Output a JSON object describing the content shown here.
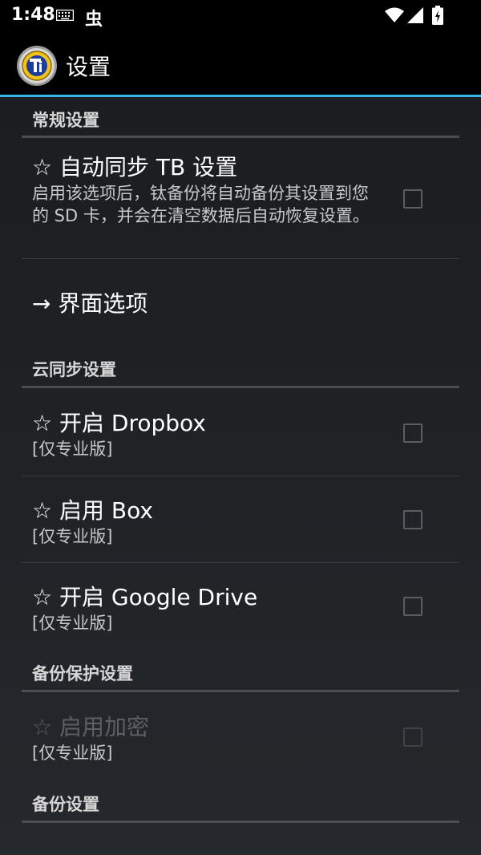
{
  "status_bar": {
    "time": "1:48",
    "notif_icon_glyph": "虫",
    "icons": [
      "keyboard-icon",
      "bug-icon",
      "wifi-icon",
      "signal-icon",
      "battery-charging-icon"
    ]
  },
  "action_bar": {
    "title": "设置",
    "accent_color": "#33b5e5"
  },
  "sections": {
    "general": {
      "header": "常规设置",
      "auto_sync": {
        "title": "☆ 自动同步 TB 设置",
        "summary": "启用该选项后，钛备份将自动备份其设置到您的 SD 卡，并会在清空数据后自动恢复设置。",
        "checked": false
      },
      "interface": {
        "title": "→ 界面选项"
      }
    },
    "cloud": {
      "header": "云同步设置",
      "dropbox": {
        "title": "☆ 开启 Dropbox",
        "summary": "[仅专业版]",
        "checked": false
      },
      "box": {
        "title": "☆ 启用 Box",
        "summary": "[仅专业版]",
        "checked": false
      },
      "gdrive": {
        "title": "☆ 开启 Google Drive",
        "summary": "[仅专业版]",
        "checked": false
      }
    },
    "protection": {
      "header": "备份保护设置",
      "encryption": {
        "title": "☆ 启用加密",
        "summary": "[仅专业版]",
        "checked": false,
        "enabled": false
      }
    },
    "backup": {
      "header": "备份设置"
    }
  }
}
